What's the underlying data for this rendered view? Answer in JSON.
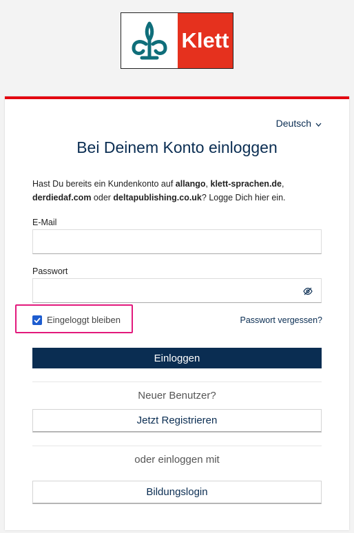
{
  "logo": {
    "wordmark": "Klett",
    "icon": "klett-fleur-icon"
  },
  "language": {
    "selected": "Deutsch",
    "icon": "chevron-down-icon"
  },
  "title": "Bei Deinem Konto einloggen",
  "intro": {
    "p1": "Hast Du bereits ein Kundenkonto auf ",
    "b1": "allango",
    "p2": ", ",
    "b2": "klett-sprachen.de",
    "p3": ", ",
    "b3": "derdiedaf.com",
    "p4": " oder ",
    "b4": "deltapublishing.co.uk",
    "p5": "? Logge Dich hier ein."
  },
  "form": {
    "email_label": "E-Mail",
    "email_value": "",
    "password_label": "Passwort",
    "password_value": "",
    "password_toggle_icon": "eye-slash-icon",
    "remember_label": "Eingeloggt bleiben",
    "remember_checked": true,
    "forgot_label": "Passwort vergessen?",
    "login_label": "Einloggen"
  },
  "register": {
    "prompt": "Neuer Benutzer?",
    "button_label": "Jetzt Registrieren"
  },
  "alt_login": {
    "prompt": "oder einloggen mit",
    "button_label": "Bildungslogin"
  },
  "colors": {
    "brand_red": "#e5311e",
    "navy": "#0a2d52",
    "highlight": "#e2197c",
    "checkbox": "#1d5ccf"
  }
}
